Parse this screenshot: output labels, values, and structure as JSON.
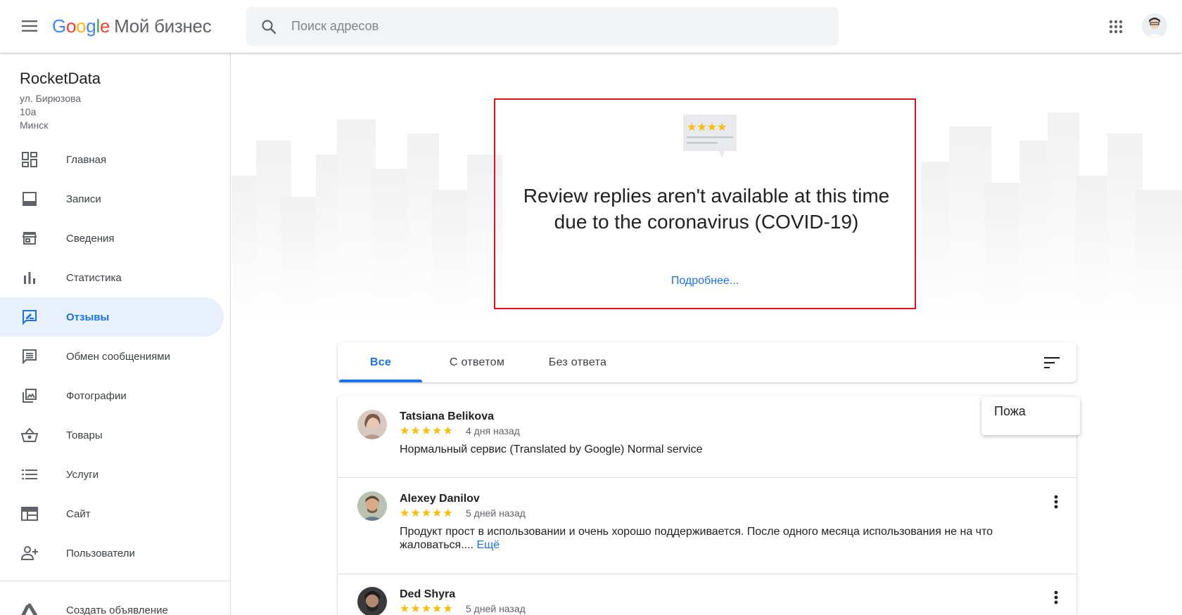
{
  "header": {
    "logo_google": [
      "G",
      "o",
      "o",
      "g",
      "l",
      "e"
    ],
    "product": "Мой бизнес",
    "search_placeholder": "Поиск адресов"
  },
  "sidebar": {
    "business_name": "RocketData",
    "address_lines": [
      "ул. Бирюзова",
      "10а",
      "Минск"
    ],
    "items": [
      {
        "label": "Главная",
        "icon": "dashboard-icon"
      },
      {
        "label": "Записи",
        "icon": "posts-icon"
      },
      {
        "label": "Сведения",
        "icon": "storefront-icon"
      },
      {
        "label": "Статистика",
        "icon": "bar-chart-icon"
      },
      {
        "label": "Отзывы",
        "icon": "rate-review-icon",
        "active": true
      },
      {
        "label": "Обмен сообщениями",
        "icon": "message-icon"
      },
      {
        "label": "Фотографии",
        "icon": "photo-library-icon"
      },
      {
        "label": "Товары",
        "icon": "shopping-basket-icon"
      },
      {
        "label": "Услуги",
        "icon": "list-icon"
      },
      {
        "label": "Сайт",
        "icon": "web-icon"
      },
      {
        "label": "Пользователи",
        "icon": "person-add-icon"
      }
    ],
    "extra": {
      "label": "Создать объявление",
      "icon": "google-ads-icon"
    }
  },
  "notice": {
    "text": "Review replies aren't available at this time due to the coronavirus (COVID-19)",
    "link": "Подробнее...",
    "highlight_color": "#e3111a"
  },
  "tabs": {
    "items": [
      "Все",
      "С ответом",
      "Без ответа"
    ],
    "active": "Все"
  },
  "reviews": [
    {
      "name": "Tatsiana Belikova",
      "stars": "★★★★★",
      "rating": 5,
      "when": "4 дня назад",
      "text": "Нормальный сервис (Translated by Google) Normal service",
      "more": ""
    },
    {
      "name": "Alexey Danilov",
      "stars": "★★★★★",
      "rating": 5,
      "when": "5 дней назад",
      "text": "Продукт прост в использовании и очень хорошо поддерживается. После одного месяца использования не на что жаловаться....",
      "more": "Ещё"
    },
    {
      "name": "Ded Shyra",
      "stars": "★★★★★",
      "rating": 5,
      "when": "5 дней назад",
      "text": "",
      "more": ""
    }
  ],
  "popup": {
    "label": "Пожа"
  },
  "colors": {
    "accent": "#1a73e8",
    "star": "#fbbc04",
    "active_bg": "#e8f0fe"
  }
}
